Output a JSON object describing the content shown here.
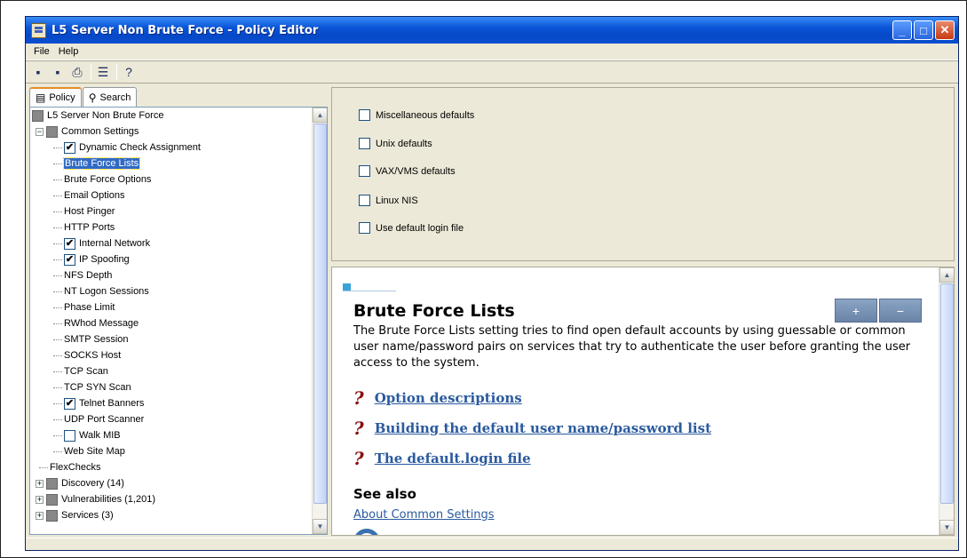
{
  "window": {
    "title": "L5 Server Non Brute Force - Policy Editor"
  },
  "menu": [
    "File",
    "Help"
  ],
  "toolbar": {
    "icons": [
      "save-icon",
      "save-as-icon",
      "print-icon",
      "tree-icon",
      "help-icon"
    ]
  },
  "tabs": [
    {
      "label": "Policy",
      "icon": "policy-icon",
      "active": true
    },
    {
      "label": "Search",
      "icon": "binoculars-icon",
      "active": false
    }
  ],
  "tree": {
    "root": "L5 Server Non Brute Force",
    "common": "Common Settings",
    "items": [
      {
        "label": "Dynamic Check Assignment",
        "checkbox": true,
        "checked": true
      },
      {
        "label": "Brute Force Lists",
        "checkbox": false,
        "selected": true
      },
      {
        "label": "Brute Force Options",
        "checkbox": false
      },
      {
        "label": "Email Options",
        "checkbox": false
      },
      {
        "label": "Host Pinger",
        "checkbox": false
      },
      {
        "label": "HTTP Ports",
        "checkbox": false
      },
      {
        "label": "Internal Network",
        "checkbox": true,
        "checked": true
      },
      {
        "label": "IP Spoofing",
        "checkbox": true,
        "checked": true
      },
      {
        "label": "NFS Depth",
        "checkbox": false
      },
      {
        "label": "NT Logon Sessions",
        "checkbox": false
      },
      {
        "label": "Phase Limit",
        "checkbox": false
      },
      {
        "label": "RWhod Message",
        "checkbox": false
      },
      {
        "label": "SMTP Session",
        "checkbox": false
      },
      {
        "label": "SOCKS Host",
        "checkbox": false
      },
      {
        "label": "TCP Scan",
        "checkbox": false
      },
      {
        "label": "TCP SYN Scan",
        "checkbox": false
      },
      {
        "label": "Telnet Banners",
        "checkbox": true,
        "checked": true
      },
      {
        "label": "UDP Port Scanner",
        "checkbox": false
      },
      {
        "label": "Walk MIB",
        "checkbox": true,
        "checked": false
      },
      {
        "label": "Web Site Map",
        "checkbox": false
      }
    ],
    "flexchecks": "FlexChecks",
    "discovery": "Discovery (14)",
    "vulnerabilities": "Vulnerabilities (1,201)",
    "services": "Services (3)"
  },
  "options": [
    "Miscellaneous defaults",
    "Unix defaults",
    "VAX/VMS defaults",
    "Linux NIS",
    "Use default login file"
  ],
  "help": {
    "title": "Brute Force Lists",
    "body": "The Brute Force Lists setting tries to find open default accounts by using guessable or common user name/password pairs on services that try to authenticate the user before granting the user access to the system.",
    "links": [
      "Option descriptions",
      "Building the default user name/password list",
      "The default.login file"
    ],
    "see_also": "See also",
    "about_link": "About Common Settings",
    "plus": "+",
    "minus": "−"
  }
}
